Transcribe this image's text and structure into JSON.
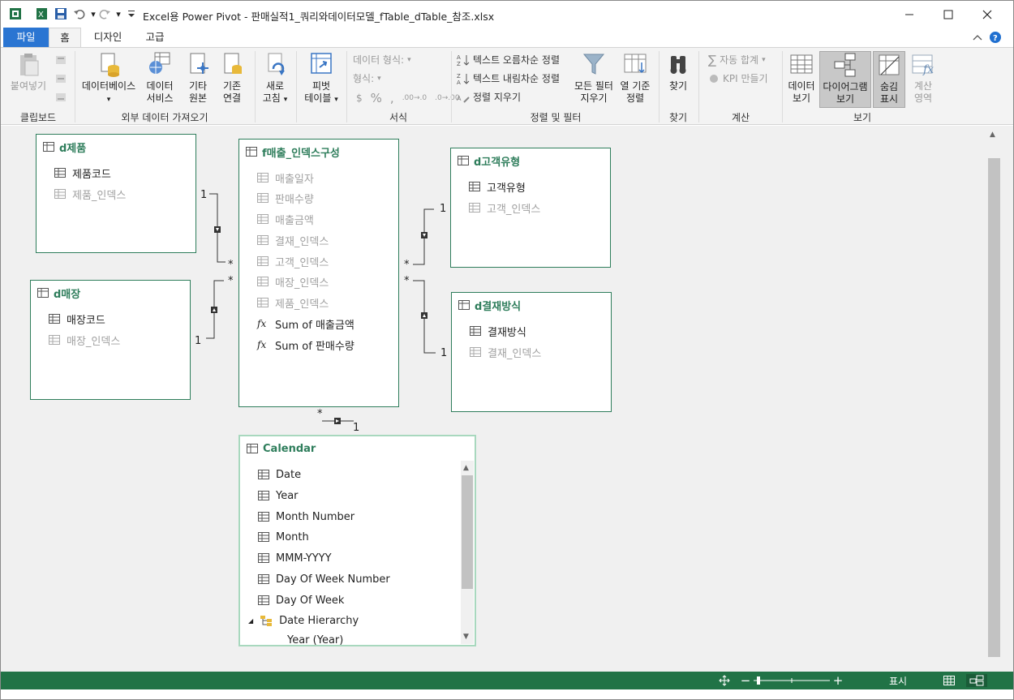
{
  "window": {
    "title": "Excel용 Power Pivot - 판매실적1_쿼리와데이터모델_fTable_dTable_참조.xlsx"
  },
  "tabs": [
    {
      "label": "파일"
    },
    {
      "label": "홈"
    },
    {
      "label": "디자인"
    },
    {
      "label": "고급"
    }
  ],
  "ribbon": {
    "clipboard": {
      "paste": "붙여넣기",
      "group": "클립보드"
    },
    "external": {
      "database": "데이터베이스",
      "service": "데이터\n서비스",
      "other": "기타\n원본",
      "existing": "기존\n연결",
      "group": "외부 데이터 가져오기"
    },
    "refresh": {
      "label": "새로\n고침"
    },
    "pivot": {
      "label": "피벗\n테이블"
    },
    "format": {
      "data_type": "데이터 형식:",
      "format": "형식:",
      "dollar": "$",
      "percent": "%",
      "comma": ",",
      "dec_inc": ".00→.0",
      "dec_dec": ".0→.00",
      "group": "서식"
    },
    "sort": {
      "asc": "텍스트 오름차순 정렬",
      "desc": "텍스트 내림차순 정렬",
      "clear_sort": "정렬 지우기",
      "clear_filter": "모든 필터\n지우기",
      "by_column": "열 기준\n정렬",
      "group": "정렬 및 필터"
    },
    "find": {
      "label": "찾기",
      "group": "찾기"
    },
    "calc": {
      "autosum": "자동 합계",
      "kpi": "KPI 만들기",
      "group": "계산"
    },
    "view": {
      "data_view": "데이터\n보기",
      "diagram_view": "다이어그램\n보기",
      "show_hidden": "숨김\n표시",
      "calc_area": "계산\n영역",
      "group": "보기"
    }
  },
  "tables": {
    "dproduct": {
      "name": "d제품",
      "columns": [
        {
          "name": "제품코드",
          "hidden": false
        },
        {
          "name": "제품_인덱스",
          "hidden": true
        }
      ]
    },
    "dstore": {
      "name": "d매장",
      "columns": [
        {
          "name": "매장코드",
          "hidden": false
        },
        {
          "name": "매장_인덱스",
          "hidden": true
        }
      ]
    },
    "fsales": {
      "name": "f매출_인덱스구성",
      "columns": [
        {
          "name": "매출일자",
          "hidden": true
        },
        {
          "name": "판매수량",
          "hidden": true
        },
        {
          "name": "매출금액",
          "hidden": true
        },
        {
          "name": "결재_인덱스",
          "hidden": true
        },
        {
          "name": "고객_인덱스",
          "hidden": true
        },
        {
          "name": "매장_인덱스",
          "hidden": true
        },
        {
          "name": "제품_인덱스",
          "hidden": true
        }
      ],
      "measures": [
        "Sum of 매출금액",
        "Sum of 판매수량"
      ]
    },
    "dcustomer": {
      "name": "d고객유형",
      "columns": [
        {
          "name": "고객유형",
          "hidden": false
        },
        {
          "name": "고객_인덱스",
          "hidden": true
        }
      ]
    },
    "dpayment": {
      "name": "d결재방식",
      "columns": [
        {
          "name": "결재방식",
          "hidden": false
        },
        {
          "name": "결재_인덱스",
          "hidden": true
        }
      ]
    },
    "calendar": {
      "name": "Calendar",
      "columns": [
        {
          "name": "Date"
        },
        {
          "name": "Year"
        },
        {
          "name": "Month Number"
        },
        {
          "name": "Month"
        },
        {
          "name": "MMM-YYYY"
        },
        {
          "name": "Day Of Week Number"
        },
        {
          "name": "Day Of Week"
        }
      ],
      "hierarchy": "Date Hierarchy",
      "hierarchy_child": "Year (Year)"
    }
  },
  "relations": {
    "one": "1",
    "many": "*"
  },
  "statusbar": {
    "display": "표시"
  },
  "colors": {
    "accent": "#217346",
    "file_tab": "#2a75d2",
    "table_border": "#2e7d5b",
    "arrow": "#e02020"
  }
}
